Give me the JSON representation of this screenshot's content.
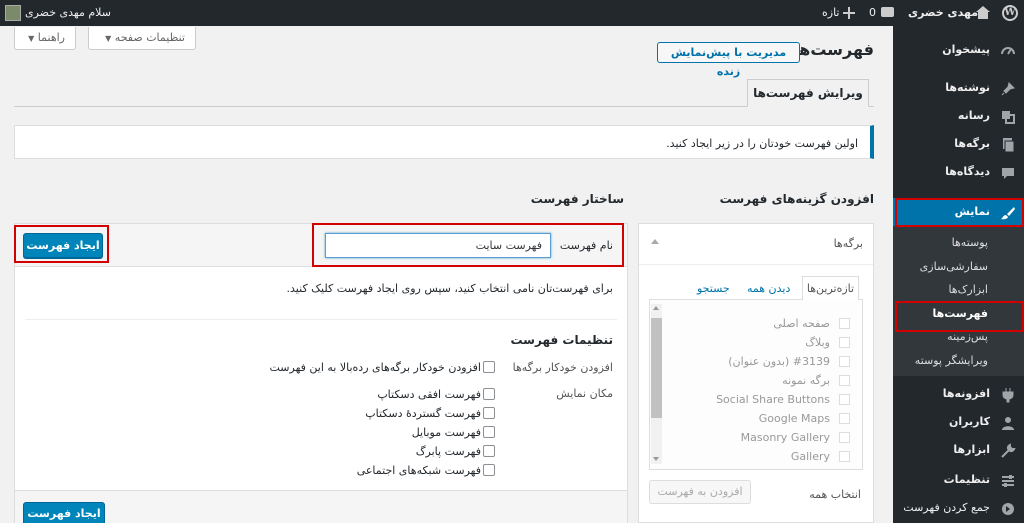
{
  "adminbar": {
    "greeting": "سلام مهدی خضری",
    "site_name": "مهدی خضری",
    "comments_count": "0",
    "new_label": "تازه"
  },
  "sidebar": {
    "items": [
      {
        "label": "پیشخوان",
        "icon": "dashboard-icon"
      },
      {
        "label": "نوشته‌ها",
        "icon": "pin-icon"
      },
      {
        "label": "رسانه",
        "icon": "media-icon"
      },
      {
        "label": "برگه‌ها",
        "icon": "page-icon"
      },
      {
        "label": "دیدگاه‌ها",
        "icon": "comment-icon"
      },
      {
        "label": "نمایش",
        "icon": "brush-icon"
      },
      {
        "label": "افزونه‌ها",
        "icon": "plugin-icon"
      },
      {
        "label": "کاربران",
        "icon": "users-icon"
      },
      {
        "label": "ابزارها",
        "icon": "tools-icon"
      },
      {
        "label": "تنظیمات",
        "icon": "settings-icon"
      },
      {
        "label": "جمع کردن فهرست",
        "icon": "collapse-icon"
      }
    ],
    "submenu": [
      "پوسته‌ها",
      "سفارشی‌سازی",
      "ابزارک‌ها",
      "فهرست‌ها",
      "پس‌زمینه",
      "ویرایشگر پوسته"
    ]
  },
  "header": {
    "screen_options": "تنظیمات صفحه",
    "help": "راهنما",
    "page_title": "فهرست‌ها",
    "live_preview": "مدیریت با پیش‌نمایش زنده",
    "tab_edit": "ویرایش فهرست‌ها"
  },
  "notice": "اولین فهرست خودتان را در زیر ایجاد کنید.",
  "add_items": {
    "title": "افزودن گزینه‌های فهرست",
    "pages_box": "برگه‌ها",
    "tabs": [
      "تازه‌ترین‌ها",
      "دیدن همه",
      "جستجو"
    ],
    "pages": [
      "صفحه اصلی",
      "وبلاگ",
      "#3139 (بدون عنوان)",
      "برگه نمونه",
      "Social Share Buttons",
      "Google Maps",
      "Masonry Gallery",
      "Gallery"
    ],
    "select_all": "انتخاب همه",
    "add_button": "افزودن به فهرست"
  },
  "structure": {
    "title": "ساختار فهرست",
    "name_label": "نام فهرست",
    "name_value": "فهرست سایت",
    "create_button": "ایجاد فهرست",
    "instructions": "برای فهرست‌تان نامی انتخاب کنید، سپس روی ایجاد فهرست کلیک کنید.",
    "settings_title": "تنظیمات فهرست",
    "auto_add_label": "افزودن خودکار برگه‌ها",
    "auto_add_option": "افزودن خودکار برگه‌های رده‌بالا به این فهرست",
    "locations_label": "مکان نمایش",
    "locations": [
      "فهرست افقی دسکتاپ",
      "فهرست گستردهٔ دسکتاپ",
      "فهرست موبایل",
      "فهرست پابرگ",
      "فهرست شبکه‌های اجتماعی"
    ]
  },
  "colors": {
    "accent": "#0073aa",
    "button": "#0085ba",
    "highlight": "#d30000",
    "sidebar": "#23282d"
  }
}
